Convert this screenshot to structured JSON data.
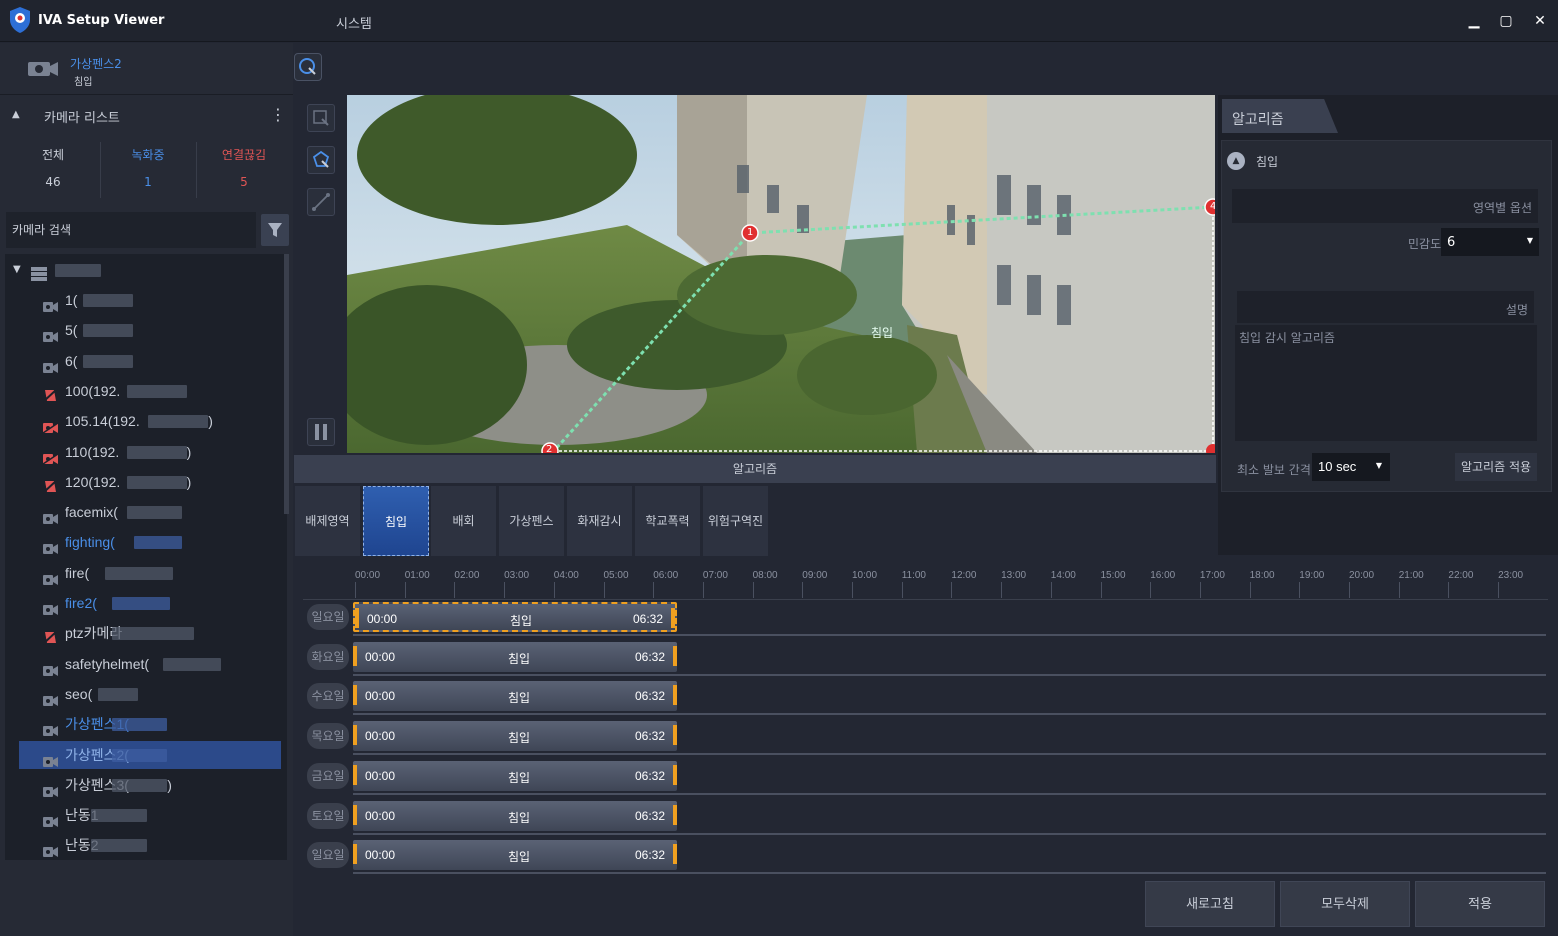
{
  "app": {
    "title": "IVA Setup Viewer",
    "menu": "시스템",
    "min": "▁",
    "max": "▢",
    "close": "✕"
  },
  "camera": {
    "name": "가상펜스2",
    "status": "침입"
  },
  "camera_list": {
    "title": "카메라 리스트",
    "collapse": "▲",
    "more": "⋮",
    "stats": [
      {
        "label": "전체",
        "value": "46"
      },
      {
        "label": "녹화중",
        "value": "1"
      },
      {
        "label": "연결끊김",
        "value": "5"
      }
    ],
    "search_placeholder": "카메라 검색",
    "items": [
      {
        "label": "1(",
        "type": "cam"
      },
      {
        "label": "5(",
        "type": "cam"
      },
      {
        "label": "6(",
        "type": "cam"
      },
      {
        "label": "100(192.",
        "type": "ptz-off"
      },
      {
        "label": "105.14(192.",
        "type": "cam-off",
        "suffix": ")"
      },
      {
        "label": "110(192.",
        "type": "cam-off",
        "suffix": ")"
      },
      {
        "label": "120(192.",
        "type": "ptz-off",
        "suffix": ")"
      },
      {
        "label": "facemix(",
        "type": "cam"
      },
      {
        "label": "fighting(",
        "type": "cam-blue"
      },
      {
        "label": "fire(",
        "type": "cam"
      },
      {
        "label": "fire2(",
        "type": "cam-blue"
      },
      {
        "label": "ptz카메라",
        "type": "ptz-off"
      },
      {
        "label": "safetyhelmet(",
        "type": "cam"
      },
      {
        "label": "seo(",
        "type": "cam"
      },
      {
        "label": "가상펜스1(",
        "type": "cam-blue"
      },
      {
        "label": "가상펜스2(",
        "type": "cam-selected"
      },
      {
        "label": "가상펜스3(",
        "type": "cam",
        "suffix": ")"
      },
      {
        "label": "난동1",
        "type": "cam"
      },
      {
        "label": "난동2",
        "type": "cam"
      }
    ]
  },
  "video": {
    "zone_label": "침입",
    "point1": "1",
    "point2": "2",
    "point4": "4"
  },
  "algorithm_bar": "알고리즘",
  "tabs": [
    "배제영역",
    "침입",
    "배회",
    "가상펜스",
    "화재감시",
    "학교폭력",
    "위험구역진입"
  ],
  "panel": {
    "title": "알고리즘",
    "section": "침입",
    "region_option": "영역별 옵션",
    "sensitivity_label": "민감도",
    "sensitivity_value": "6",
    "desc_label": "설명",
    "desc_text": "침입 감시 알고리즘",
    "interval_label": "최소 발보 간격",
    "interval_value": "10 sec",
    "apply_algo": "알고리즘 적용"
  },
  "timeline": {
    "ticks": [
      "00:00",
      "01:00",
      "02:00",
      "03:00",
      "04:00",
      "05:00",
      "06:00",
      "07:00",
      "08:00",
      "09:00",
      "10:00",
      "11:00",
      "12:00",
      "13:00",
      "14:00",
      "15:00",
      "16:00",
      "17:00",
      "18:00",
      "19:00",
      "20:00",
      "21:00",
      "22:00",
      "23:00"
    ],
    "days": [
      "일요일",
      "화요일",
      "수요일",
      "목요일",
      "금요일",
      "토요일",
      "일요일"
    ],
    "bar": {
      "start": "00:00",
      "label": "침입",
      "end": "06:32"
    }
  },
  "buttons": {
    "refresh": "새로고침",
    "delete_all": "모두삭제",
    "apply": "적용"
  },
  "colors": {
    "accent": "#4a8fe8",
    "red": "#e05555",
    "zone": "#7ee0b0"
  }
}
